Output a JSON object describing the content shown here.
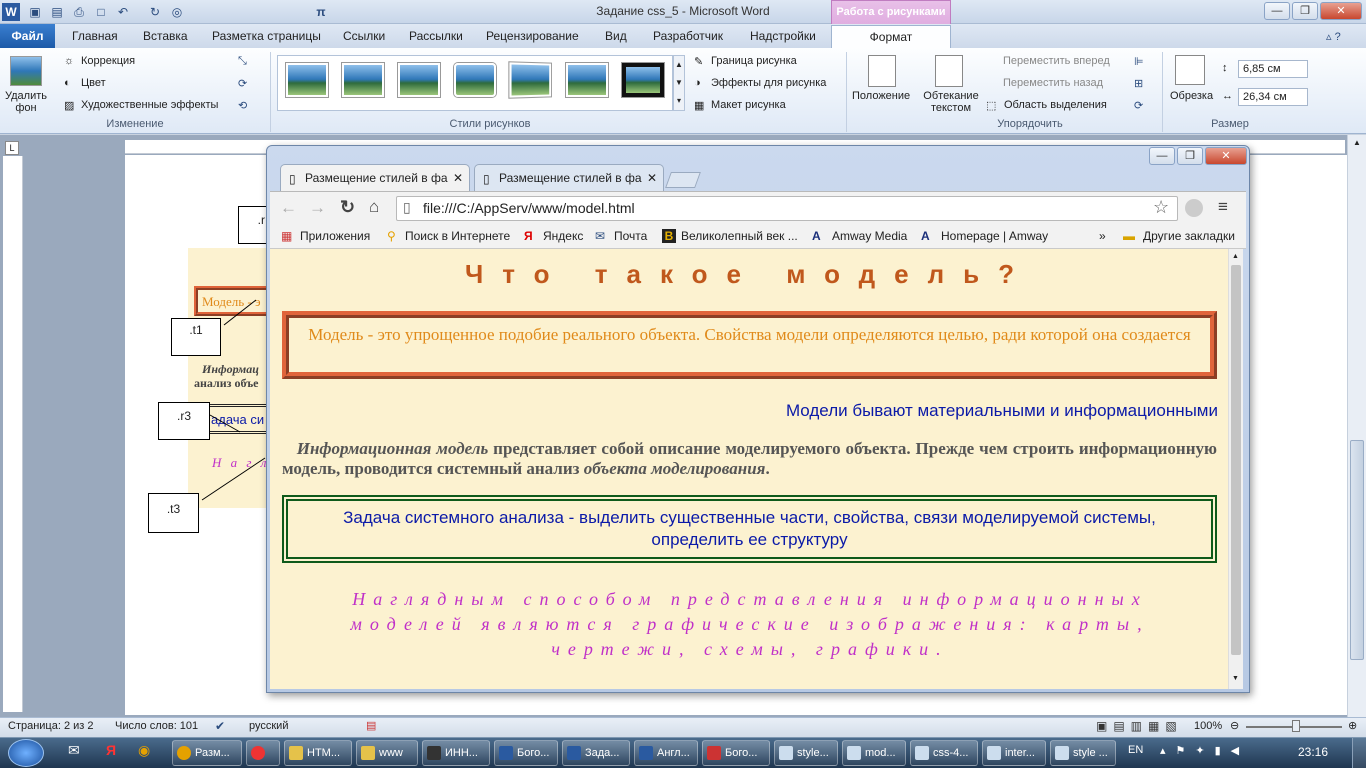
{
  "window": {
    "title": "Задание css_5  -  Microsoft Word",
    "context_tab_title": "Работа с рисунками"
  },
  "ribbon_tabs": [
    "Файл",
    "Главная",
    "Вставка",
    "Разметка страницы",
    "Ссылки",
    "Рассылки",
    "Рецензирование",
    "Вид",
    "Разработчик",
    "Надстройки",
    "Формат"
  ],
  "ribbon": {
    "remove_bg": "Удалить фон",
    "correction": "Коррекция",
    "color": "Цвет",
    "art_effects": "Художественные эффекты",
    "group_change": "Изменение",
    "group_styles": "Стили рисунков",
    "border": "Граница рисунка",
    "effects": "Эффекты для рисунка",
    "layout": "Макет рисунка",
    "position": "Положение",
    "wrap": "Обтекание текстом",
    "forward": "Переместить вперед",
    "backward": "Переместить назад",
    "selection_pane": "Область выделения",
    "group_arrange": "Упорядочить",
    "crop": "Обрезка",
    "height": "6,85 см",
    "width": "26,34 см",
    "group_size": "Размер"
  },
  "word_doc": {
    "labels": [
      ".r",
      ".t1",
      ".r3",
      ".t3"
    ],
    "snippet_model": "Модель - э",
    "snippet_info1": "Информац",
    "snippet_info2": "анализ объе",
    "snippet_task": "адача си",
    "snippet_vis": "Н а г л я"
  },
  "status": {
    "page": "Страница: 2 из 2",
    "words": "Число слов: 101",
    "language": "русский",
    "zoom": "100%"
  },
  "browser": {
    "tabs": [
      {
        "label": "Размещение стилей в фа"
      },
      {
        "label": "Размещение стилей в фа"
      }
    ],
    "url": "file:///C:/AppServ/www/model.html",
    "bookmarks": [
      "Приложения",
      "Поиск в Интернете",
      "Яндекс",
      "Почта",
      "Великолепный век ...",
      "Amway Media",
      "Homepage | Amway"
    ],
    "other_bookmarks": "Другие закладки",
    "more": "»"
  },
  "page": {
    "heading": "Что такое модель?",
    "box1": "Модель - это упрощенное подобие реального объекта. Свойства модели определяются целью, ради которой она создается",
    "right_text": "Модели бывают материальными и информационными",
    "info_em": "Информационная модель",
    "info_mid": " представляет собой описание моделируемого объекта. Прежде чем строить информационную модель, проводится системный анализ ",
    "info_em2": "объекта моделирования",
    "info_end": ".",
    "box2": "Задача системного анализа - выделить существенные части, свойства, связи моделируемой системы, определить ее структуру",
    "visual": "Наглядным способом представления информационных моделей являются графические изображения: карты, чертежи, схемы, графики."
  },
  "taskbar": {
    "items": [
      "Разм...",
      "",
      "НТМ...",
      "www",
      "ИНН...",
      "Бого...",
      "Зада...",
      "Англ...",
      "Бого...",
      "style...",
      "mod...",
      "css-4...",
      "inter...",
      "style ..."
    ],
    "lang": "EN",
    "time": "23:16"
  },
  "colors": {
    "heading": "#c0581c",
    "box1_border": "#e0643a",
    "box1_text": "#e08a1a",
    "blue_text": "#0b1aa8",
    "box2_border": "#0e5a1a",
    "visual_text": "#c030c8",
    "page_bg": "#fcf2d0"
  }
}
